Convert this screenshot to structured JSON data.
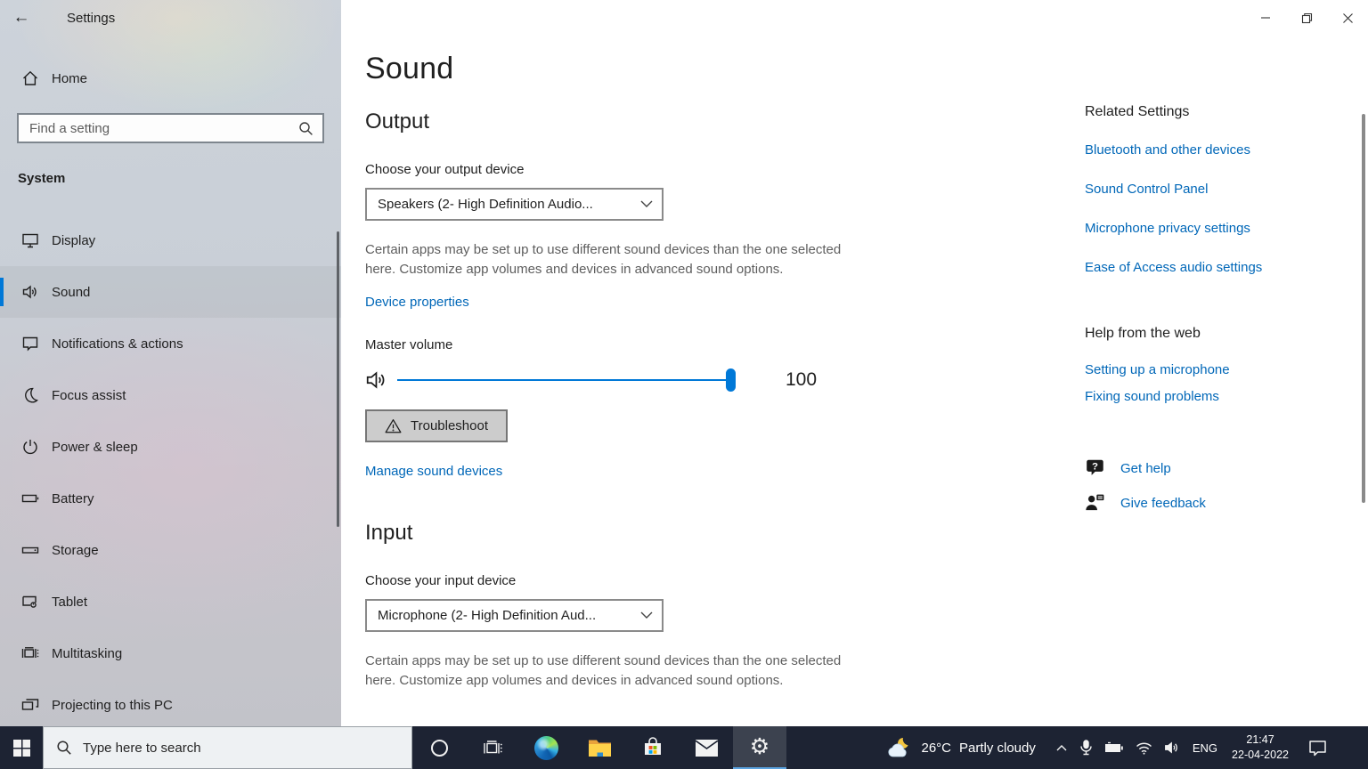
{
  "colors": {
    "accent": "#0078d7",
    "link": "#0067b8",
    "taskbar_bg": "#1d2333",
    "sidebar_acrylic": "#c9cfd6",
    "selection_bar": "#0078d7"
  },
  "titlebar": {
    "title": "Settings"
  },
  "window_controls": {
    "icons": [
      "minimize-icon",
      "restore-icon",
      "close-icon"
    ]
  },
  "sidebar": {
    "home_label": "Home",
    "search_placeholder": "Find a setting",
    "search_icon": "search-icon",
    "section_label": "System",
    "items": [
      {
        "label": "Display",
        "icon": "display-icon",
        "selected": false
      },
      {
        "label": "Sound",
        "icon": "speaker-icon",
        "selected": true
      },
      {
        "label": "Notifications & actions",
        "icon": "notifications-icon",
        "selected": false
      },
      {
        "label": "Focus assist",
        "icon": "moon-icon",
        "selected": false
      },
      {
        "label": "Power & sleep",
        "icon": "power-icon",
        "selected": false
      },
      {
        "label": "Battery",
        "icon": "battery-icon",
        "selected": false
      },
      {
        "label": "Storage",
        "icon": "storage-icon",
        "selected": false
      },
      {
        "label": "Tablet",
        "icon": "tablet-icon",
        "selected": false
      },
      {
        "label": "Multitasking",
        "icon": "multitasking-icon",
        "selected": false
      },
      {
        "label": "Projecting to this PC",
        "icon": "projecting-icon",
        "selected": false
      }
    ]
  },
  "main": {
    "title": "Sound",
    "output": {
      "heading": "Output",
      "device_label": "Choose your output device",
      "device_value": "Speakers (2- High Definition Audio...",
      "description": "Certain apps may be set up to use different sound devices than the one selected here. Customize app volumes and devices in advanced sound options.",
      "device_properties_link": "Device properties",
      "master_volume_label": "Master volume",
      "volume_value": "100",
      "troubleshoot_button": "Troubleshoot",
      "manage_link": "Manage sound devices"
    },
    "input": {
      "heading": "Input",
      "device_label": "Choose your input device",
      "device_value": "Microphone (2- High Definition Aud...",
      "description": "Certain apps may be set up to use different sound devices than the one selected here. Customize app volumes and devices in advanced sound options."
    }
  },
  "related": {
    "heading": "Related Settings",
    "links": [
      "Bluetooth and other devices",
      "Sound Control Panel",
      "Microphone privacy settings",
      "Ease of Access audio settings"
    ]
  },
  "help": {
    "heading": "Help from the web",
    "links": [
      "Setting up a microphone",
      "Fixing sound problems"
    ],
    "get_help": "Get help",
    "give_feedback": "Give feedback"
  },
  "taskbar": {
    "search_placeholder": "Type here to search",
    "app_icons": [
      "start-icon",
      "cortana-icon",
      "task-view-icon",
      "edge-icon",
      "file-explorer-icon",
      "store-icon",
      "mail-icon",
      "settings-gear-icon"
    ],
    "active_app": "settings-gear-icon",
    "weather_temp": "26°C",
    "weather_condition": "Partly cloudy",
    "tray_icons": [
      "chevron-up-icon",
      "microphone-icon",
      "battery-icon",
      "wifi-icon",
      "volume-icon"
    ],
    "language": "ENG",
    "time": "21:47",
    "date": "22-04-2022",
    "notification_icon": "notification-icon"
  }
}
